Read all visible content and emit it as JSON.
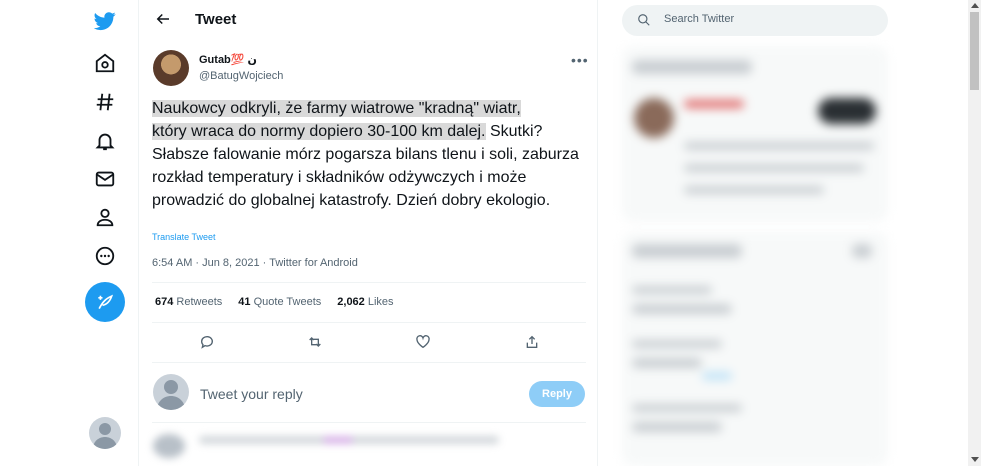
{
  "nav": {
    "items": [
      {
        "icon": "twitter-logo-icon"
      },
      {
        "icon": "home-icon"
      },
      {
        "icon": "explore-hashtag-icon"
      },
      {
        "icon": "notifications-bell-icon"
      },
      {
        "icon": "messages-envelope-icon"
      },
      {
        "icon": "profile-icon"
      },
      {
        "icon": "more-circle-icon"
      }
    ],
    "compose_icon": "compose-feather-icon",
    "brand_color": "#1d9bf0"
  },
  "header": {
    "title": "Tweet"
  },
  "tweet": {
    "author_name": "Gutab💯 ن",
    "author_handle": "@BatugWojciech",
    "text_highlighted_line1": "Naukowcy odkryli, że farmy wiatrowe \"kradną\" wiatr,",
    "text_highlighted_line2": "który wraca do normy dopiero 30-100 km dalej.",
    "text_rest": " Skutki? Słabsze falowanie mórz pogarsza bilans tlenu i soli, zaburza rozkład temperatury i składników odżywczych i może prowadzić do globalnej katastrofy. Dzień dobry ekologio.",
    "translate_label": "Translate Tweet",
    "meta": "6:54 AM · Jun 8, 2021 · Twitter for Android",
    "retweets_count": "674",
    "retweets_label": "Retweets",
    "quotes_count": "41",
    "quotes_label": "Quote Tweets",
    "likes_count": "2,062",
    "likes_label": "Likes"
  },
  "reply": {
    "placeholder": "Tweet your reply",
    "button_label": "Reply"
  },
  "search": {
    "placeholder": "Search Twitter"
  }
}
